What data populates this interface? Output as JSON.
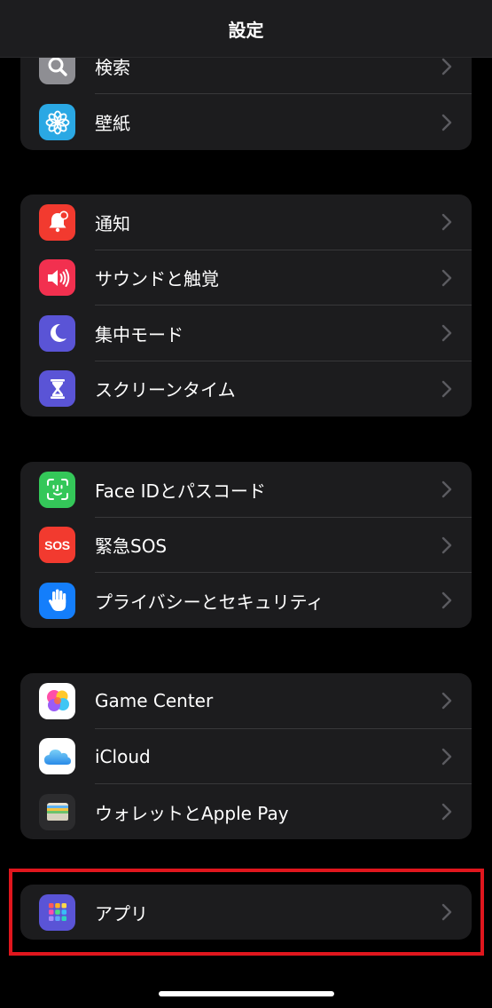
{
  "header": {
    "title": "設定"
  },
  "groups": [
    {
      "items": [
        {
          "label": "検索",
          "icon": "search-icon",
          "color": "#8e8e93"
        },
        {
          "label": "壁紙",
          "icon": "wallpaper-flower-icon",
          "color": "#2aa8e4"
        }
      ]
    },
    {
      "items": [
        {
          "label": "通知",
          "icon": "bell-icon",
          "color": "#f23a2f"
        },
        {
          "label": "サウンドと触覚",
          "icon": "speaker-icon",
          "color": "#f2304f"
        },
        {
          "label": "集中モード",
          "icon": "moon-icon",
          "color": "#5a54d6"
        },
        {
          "label": "スクリーンタイム",
          "icon": "hourglass-icon",
          "color": "#5a54d6"
        }
      ]
    },
    {
      "items": [
        {
          "label": "Face IDとパスコード",
          "icon": "face-id-icon",
          "color": "#34c759"
        },
        {
          "label": "緊急SOS",
          "icon": "sos-icon",
          "icon_text": "SOS",
          "color": "#f23a2f"
        },
        {
          "label": "プライバシーとセキュリティ",
          "icon": "hand-icon",
          "color": "#147efb"
        }
      ]
    },
    {
      "items": [
        {
          "label": "Game Center",
          "icon": "game-center-icon",
          "color": "#ffffff"
        },
        {
          "label": "iCloud",
          "icon": "icloud-icon",
          "color": "#ffffff"
        },
        {
          "label": "ウォレットとApple Pay",
          "icon": "wallet-icon",
          "color": "#2c2c2e"
        }
      ]
    },
    {
      "items": [
        {
          "label": "アプリ",
          "icon": "apps-grid-icon",
          "color": "#5a54d6"
        }
      ]
    }
  ],
  "highlight_color": "#e0161d"
}
